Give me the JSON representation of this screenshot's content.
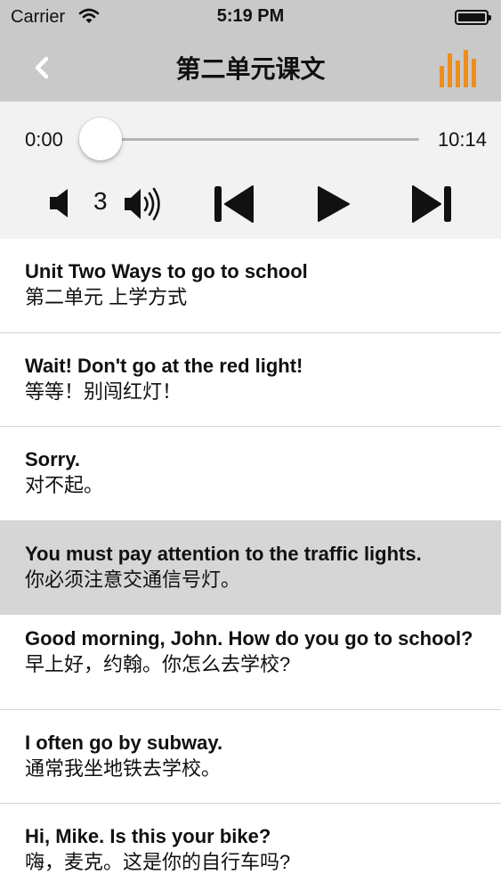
{
  "status_bar": {
    "carrier": "Carrier",
    "time": "5:19 PM"
  },
  "nav": {
    "title": "第二单元课文",
    "accent_color": "#f08c1a",
    "back_icon": "chevron-left-icon",
    "right_icon": "equalizer-bars-icon"
  },
  "player": {
    "current_time": "0:00",
    "total_time": "10:14",
    "progress": 0.0,
    "volume_level": "3"
  },
  "sentences": [
    {
      "en": "Unit Two Ways to go to school",
      "zh": "第二单元 上学方式",
      "selected": false
    },
    {
      "en": "Wait! Don't go at the red light!",
      "zh": "等等！别闯红灯！",
      "selected": false
    },
    {
      "en": "Sorry.",
      "zh": "对不起。",
      "selected": false
    },
    {
      "en": "You must pay attention to the traffic lights.",
      "zh": "你必须注意交通信号灯。",
      "selected": true
    },
    {
      "en": "Good morning, John. How do you go to school?",
      "zh": "早上好，约翰。你怎么去学校?",
      "selected": false
    },
    {
      "en": "I often go by subway.",
      "zh": "通常我坐地铁去学校。",
      "selected": false
    },
    {
      "en": "Hi, Mike. Is this your bike?",
      "zh": "嗨，麦克。这是你的自行车吗?",
      "selected": false
    }
  ]
}
